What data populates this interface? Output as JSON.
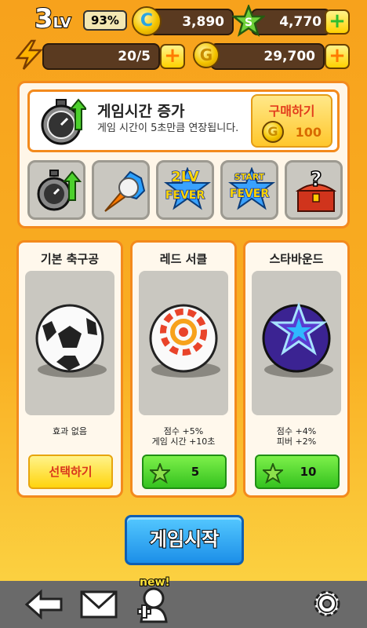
{
  "header": {
    "level_number": "3",
    "level_suffix": "LV",
    "exp_percent": "93%",
    "c_coin_label": "C",
    "c_coins": "3,890",
    "stars": "4,770",
    "energy": "20/5",
    "gold_label": "G",
    "gold": "29,700"
  },
  "featured_item": {
    "title": "게임시간 증가",
    "description": "게임 시간이 5초만큼 연장됩니다.",
    "buy_label": "구매하기",
    "price": "100"
  },
  "items": [
    {
      "name": "time-plus"
    },
    {
      "name": "power-kick"
    },
    {
      "name": "fever-2lv",
      "line1": "2LV",
      "line2": "FEVER"
    },
    {
      "name": "start-fever",
      "line1": "START",
      "line2": "FEVER"
    },
    {
      "name": "mystery-chest"
    }
  ],
  "balls": [
    {
      "name": "기본 축구공",
      "effect": "효과 없음",
      "button": "선택하기"
    },
    {
      "name": "레드 서클",
      "effect_line1": "점수 +5%",
      "effect_line2": "게임 시간 +10초",
      "price": "5"
    },
    {
      "name": "스타바운드",
      "effect_line1": "점수 +4%",
      "effect_line2": "피버 +2%",
      "price": "10"
    }
  ],
  "start_button": "게임시작",
  "nav": {
    "new_badge": "new!"
  },
  "colors": {
    "orange_bg": "#f9ae22",
    "panel_border": "#f38a1d",
    "start_blue": "#1c8fe8",
    "buy_green": "#35c21f"
  }
}
